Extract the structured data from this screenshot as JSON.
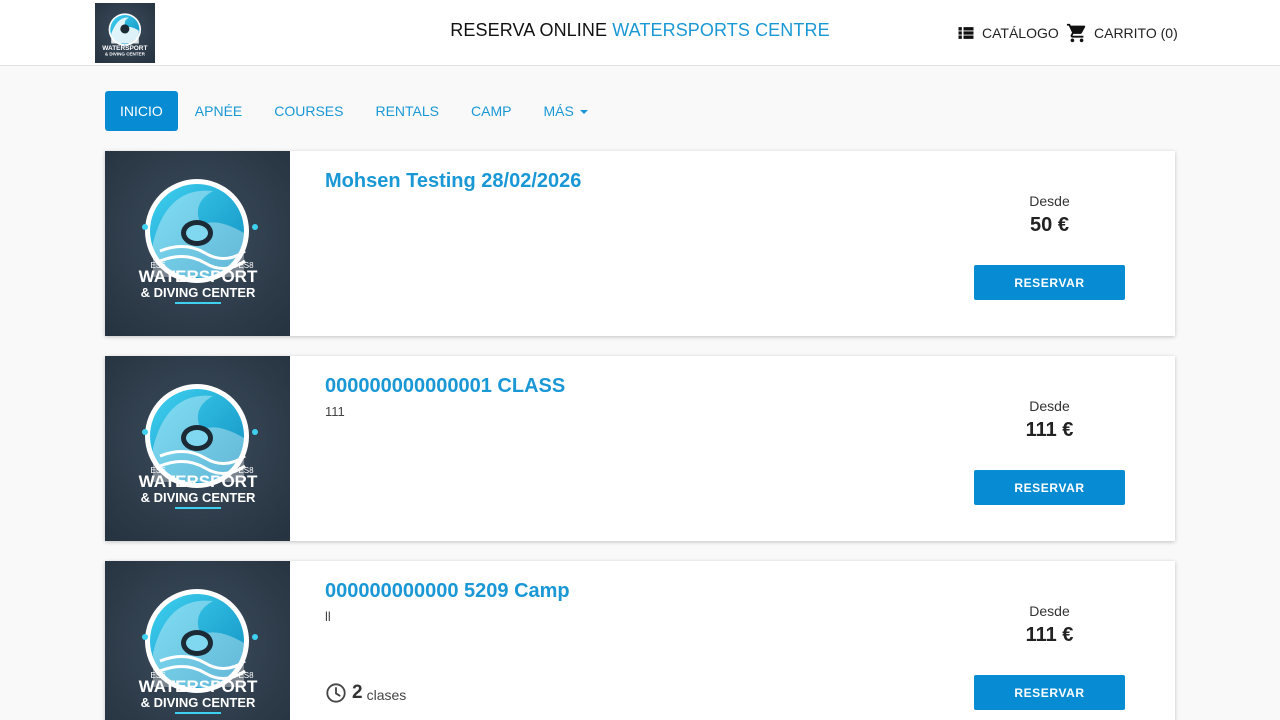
{
  "header": {
    "title_prefix": "RESERVA ONLINE",
    "title_accent": "WATERSPORTS CENTRE",
    "catalog_label": "CATÁLOGO",
    "cart_label": "CARRITO (0)",
    "logo_text_line1": "WATERSPORT",
    "logo_text_line2": "& DIVING CENTER"
  },
  "nav": {
    "items": [
      {
        "label": "INICIO",
        "active": true
      },
      {
        "label": "APNÉE"
      },
      {
        "label": "COURSES"
      },
      {
        "label": "RENTALS"
      },
      {
        "label": "CAMP"
      },
      {
        "label": "MÁS"
      }
    ]
  },
  "products": [
    {
      "title": "Mohsen Testing 28/02/2026",
      "description": "",
      "price_label": "Desde",
      "price": "50 €",
      "button_label": "RESERVAR"
    },
    {
      "title": "000000000000001 CLASS",
      "description": "111",
      "price_label": "Desde",
      "price": "111 €",
      "button_label": "RESERVAR"
    },
    {
      "title": "000000000000 5209 Camp",
      "description": "ll",
      "price_label": "Desde",
      "price": "111 €",
      "button_label": "RESERVAR",
      "duration_count": "2",
      "duration_unit": "clases"
    }
  ],
  "image": {
    "badge_left": "ES6",
    "badge_right": "ES8",
    "line1": "WATERSPORT",
    "line2": "& DIVING CENTER"
  },
  "colors": {
    "accent": "#1a98d5",
    "button": "#078cd3",
    "image_bg": "#2f3f4f"
  },
  "icons": {
    "catalog": "list-icon",
    "cart": "shopping-cart-icon",
    "duration": "clock-icon"
  }
}
